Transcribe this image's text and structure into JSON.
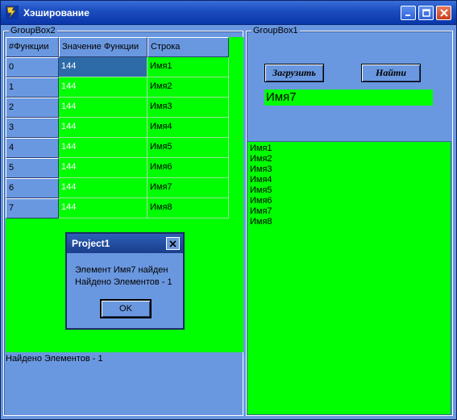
{
  "window": {
    "title": "Хэширование"
  },
  "groupbox2": {
    "label": "GroupBox2"
  },
  "groupbox1": {
    "label": "GroupBox1"
  },
  "grid": {
    "headers": [
      "#Функции",
      "Значение Функции",
      "Строка"
    ],
    "rows": [
      {
        "idx": "0",
        "value": "144",
        "name": "Имя1"
      },
      {
        "idx": "1",
        "value": "144",
        "name": "Имя2"
      },
      {
        "idx": "2",
        "value": "144",
        "name": "Имя3"
      },
      {
        "idx": "3",
        "value": "144",
        "name": "Имя4"
      },
      {
        "idx": "4",
        "value": "144",
        "name": "Имя5"
      },
      {
        "idx": "5",
        "value": "144",
        "name": "Имя6"
      },
      {
        "idx": "6",
        "value": "144",
        "name": "Имя7"
      },
      {
        "idx": "7",
        "value": "144",
        "name": "Имя8"
      }
    ]
  },
  "status": {
    "found_text": "Найдено Элементов - 1"
  },
  "buttons": {
    "load": "Загрузить",
    "find": "Найти"
  },
  "search": {
    "value": "Имя7"
  },
  "list": {
    "items": [
      "Имя1",
      "Имя2",
      "Имя3",
      "Имя4",
      "Имя5",
      "Имя6",
      "Имя7",
      "Имя8"
    ]
  },
  "dialog": {
    "title": "Project1",
    "line1": "Элемент  Имя7 найден",
    "line2": "Найдено Элементов - 1",
    "ok": "OK"
  },
  "colors": {
    "accent_green": "#00ff00",
    "window_bg": "#6a98e0",
    "selection": "#2d6aa8"
  }
}
